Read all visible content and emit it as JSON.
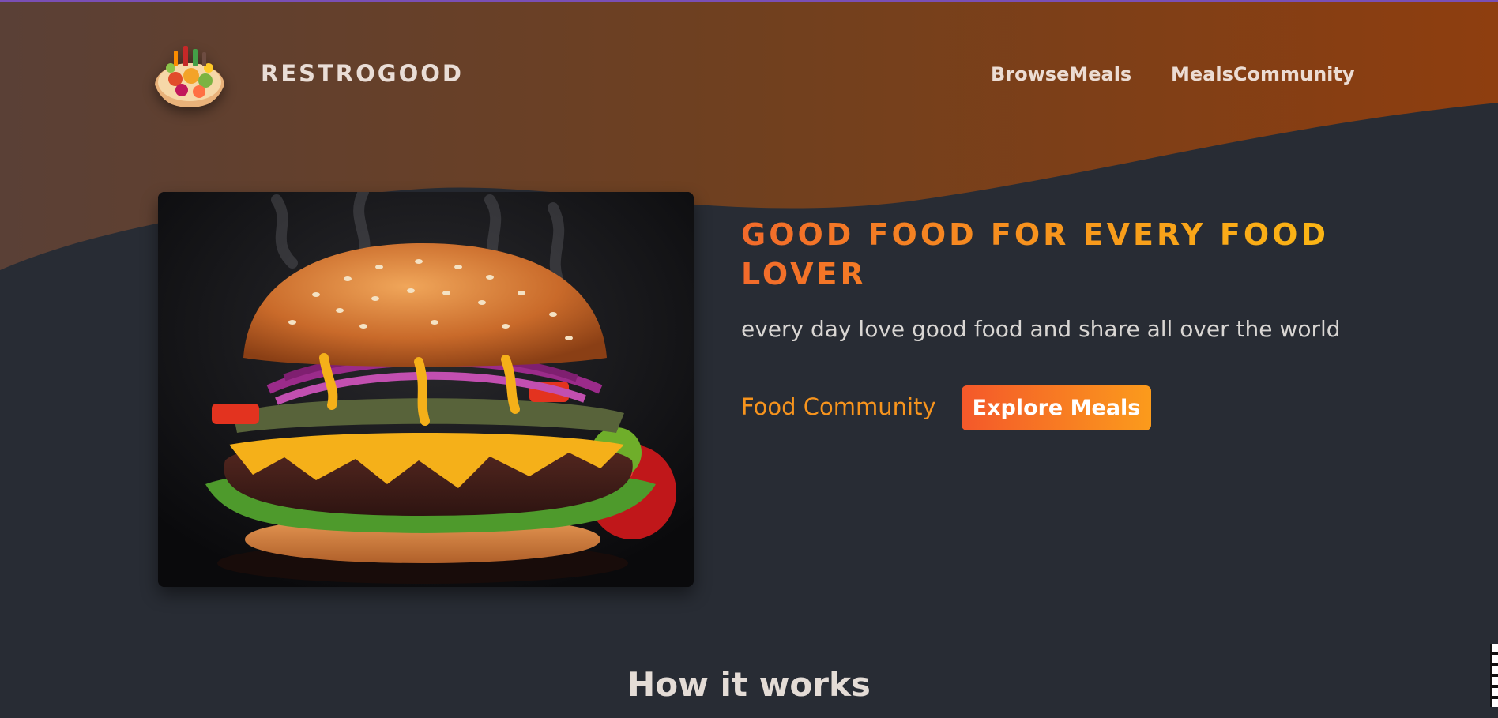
{
  "header": {
    "brand": "RESTROGOOD",
    "logo_icon": "food-platter-logo-icon",
    "nav": [
      {
        "label": "BrowseMeals"
      },
      {
        "label": "MealsCommunity"
      }
    ]
  },
  "hero": {
    "image_icon": "burger-photo",
    "title": "GOOD FOOD FOR EVERY FOOD LOVER",
    "subtitle": "every day love good food and share all over the world",
    "link_label": "Food Community",
    "button_label": "Explore Meals"
  },
  "section": {
    "title": "How it works"
  },
  "colors": {
    "accent_top": "#7a4fb5",
    "header_gradient_start": "#5a4036",
    "header_gradient_end": "#8e3e0f",
    "background": "#282c34",
    "title_gradient_start": "#f26a2b",
    "title_gradient_end": "#fbb714",
    "link": "#f7941d",
    "button_gradient_start": "#f4582a",
    "button_gradient_end": "#fb9b1c"
  }
}
